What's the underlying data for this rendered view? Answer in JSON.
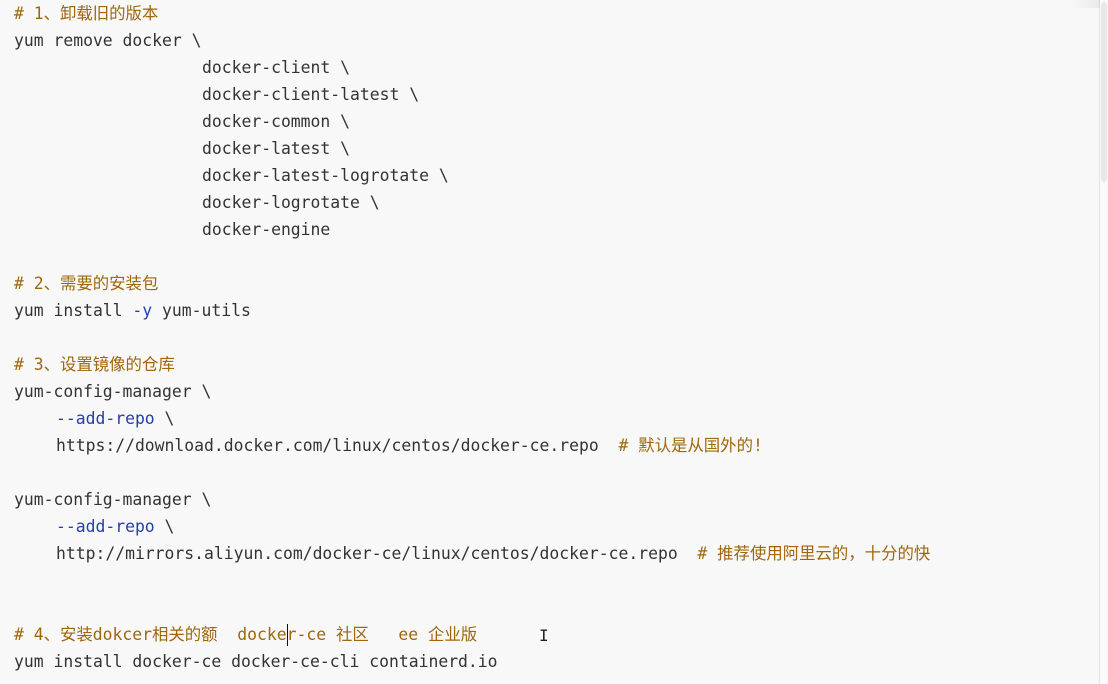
{
  "code": {
    "section1": {
      "comment": "# 1、卸载旧的版本",
      "cmd": "yum remove docker \\",
      "pkgs": [
        "docker-client \\",
        "docker-client-latest \\",
        "docker-common \\",
        "docker-latest \\",
        "docker-latest-logrotate \\",
        "docker-logrotate \\",
        "docker-engine"
      ]
    },
    "section2": {
      "comment": "# 2、需要的安装包",
      "cmd_a": "yum install ",
      "flag": "-y",
      "cmd_b": " yum-utils"
    },
    "section3": {
      "comment": "# 3、设置镜像的仓库",
      "cmd1": "yum-config-manager \\",
      "flag1": "--add-repo",
      "flag1_tail": " \\",
      "url1": "https://download.docker.com/linux/centos/docker-ce.repo  ",
      "note1": "# 默认是从国外的!",
      "cmd2": "yum-config-manager \\",
      "flag2": "--add-repo",
      "flag2_tail": " \\",
      "url2": "http://mirrors.aliyun.com/docker-ce/linux/centos/docker-ce.repo  ",
      "note2": "# 推荐使用阿里云的，十分的快"
    },
    "section4": {
      "comment": "# 4、安装dokcer相关的额  docker-ce 社区   ee 企业版",
      "cmd": "yum install docker-ce docker-ce-cli containerd.io"
    }
  },
  "cursor": {
    "ibeam_glyph": "I"
  },
  "colors": {
    "background": "#f8f8f8",
    "text": "#333333",
    "comment": "#a0660a",
    "flag": "#2340a8"
  }
}
